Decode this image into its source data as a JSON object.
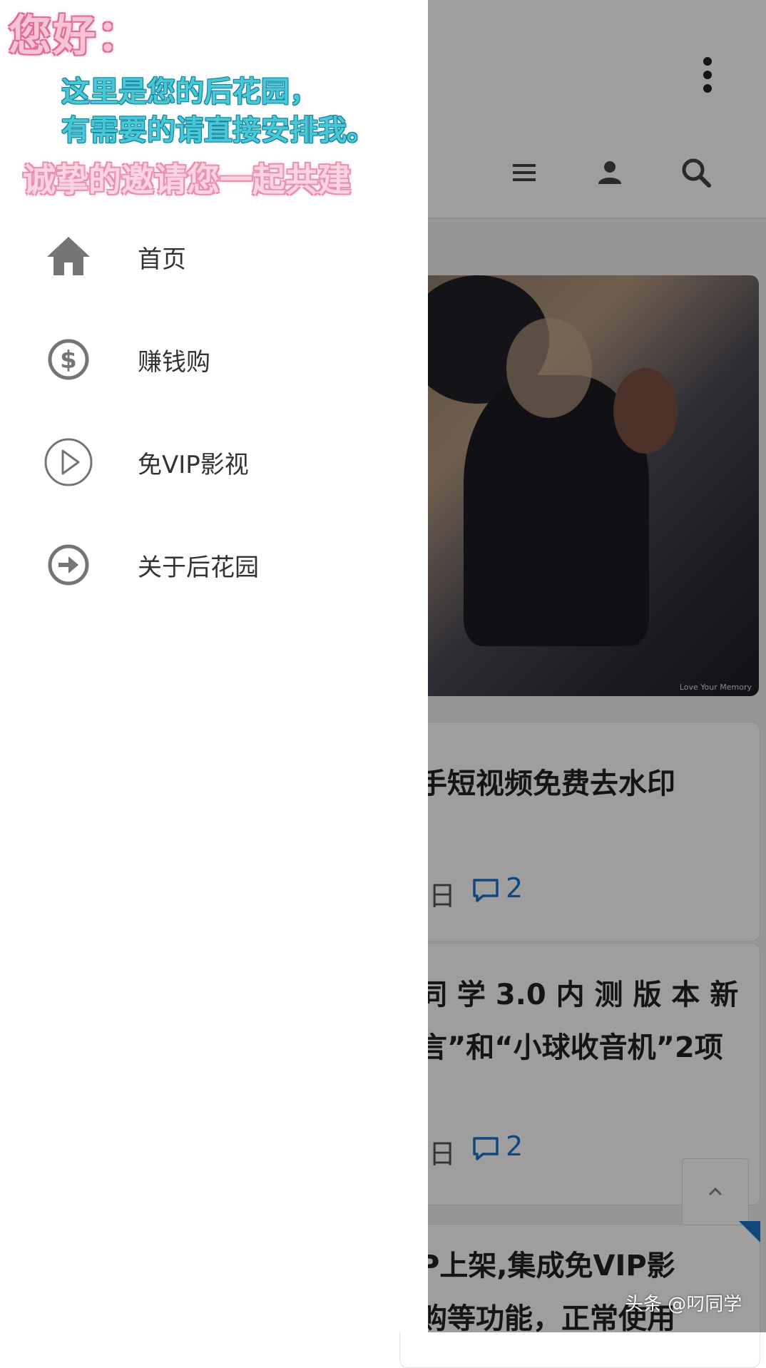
{
  "drawer": {
    "greeting": {
      "hello": "您好：",
      "line1": "这里是您的后花园，",
      "line2": "有需要的请直接安排我。",
      "invite": "诚挚的邀请您一起共建"
    },
    "items": [
      {
        "label": "首页",
        "icon": "home-icon"
      },
      {
        "label": "赚钱购",
        "icon": "dollar-circle-icon"
      },
      {
        "label": "免VIP影视",
        "icon": "play-circle-icon"
      },
      {
        "label": "关于后花园",
        "icon": "arrow-right-circle-icon"
      }
    ]
  },
  "background": {
    "toolbar_icons": [
      "more-vertical-icon",
      "menu-icon",
      "user-icon",
      "search-icon"
    ],
    "hero_caption": "Love Your Memory",
    "articles": [
      {
        "title_lines": [
          "手短视频免费去水印"
        ],
        "date_fragment": "日",
        "comments": "2"
      },
      {
        "title_lines": [
          "同 学 3.0 内 测 版 本 新",
          "言”和“小球收音机”2项"
        ],
        "date_fragment": "日",
        "comments": "2"
      },
      {
        "title_lines": [
          "P上架,集成免VIP影",
          "购等功能，正常使用"
        ]
      }
    ]
  },
  "watermark": "头条 @叼同学",
  "colors": {
    "accent": "#1a73c9",
    "greeting_pink": "#f7c4d6",
    "greeting_cyan": "#46c8d8",
    "icon_gray": "#757575"
  }
}
